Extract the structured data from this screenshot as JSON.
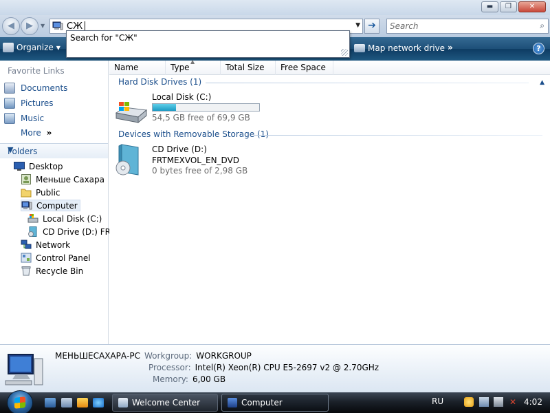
{
  "window": {
    "buttons": {
      "minimize": "▬",
      "maximize": "❐",
      "close": "✕"
    }
  },
  "address": {
    "value": "СЖ",
    "autocomplete": "Search for \"СЖ\""
  },
  "search": {
    "placeholder": "Search"
  },
  "toolbar": {
    "organize": "Organize",
    "map_network_drive": "Map network drive",
    "more": "»",
    "help": "?"
  },
  "nav": {
    "favorites_header": "Favorite Links",
    "favorites": [
      {
        "label": "Documents",
        "icon": "documents-icon"
      },
      {
        "label": "Pictures",
        "icon": "pictures-icon"
      },
      {
        "label": "Music",
        "icon": "music-icon"
      }
    ],
    "more": "More",
    "folders_header": "Folders",
    "tree": [
      {
        "label": "Desktop",
        "icon": "desktop-icon"
      },
      {
        "label": "Меньше Сахара",
        "icon": "user-folder-icon"
      },
      {
        "label": "Public",
        "icon": "folder-icon"
      },
      {
        "label": "Computer",
        "icon": "computer-icon"
      },
      {
        "label": "Local Disk (C:)",
        "icon": "hard-disk-icon"
      },
      {
        "label": "CD Drive (D:) FRT",
        "icon": "cd-drive-icon"
      },
      {
        "label": "Network",
        "icon": "network-icon"
      },
      {
        "label": "Control Panel",
        "icon": "control-panel-icon"
      },
      {
        "label": "Recycle Bin",
        "icon": "recycle-bin-icon"
      }
    ]
  },
  "columns": [
    "Name",
    "Type",
    "Total Size",
    "Free Space"
  ],
  "groups": {
    "hard_disks": "Hard Disk Drives (1)",
    "removable": "Devices with Removable Storage (1)"
  },
  "drives": {
    "c": {
      "name": "Local Disk (C:)",
      "free_text": "54,5 GB free of 69,9 GB",
      "used_fraction": 0.22
    },
    "d": {
      "name": "CD Drive (D:)",
      "label": "FRTMEXVOL_EN_DVD",
      "free_text": "0 bytes free of 2,98 GB"
    }
  },
  "details": {
    "computer_name": "МЕНЬШЕСАХАРА-PC",
    "workgroup_label": "Workgroup:",
    "workgroup": "WORKGROUP",
    "processor_label": "Processor:",
    "processor": "Intel(R) Xeon(R) CPU E5-2697 v2 @ 2.70GHz",
    "memory_label": "Memory:",
    "memory": "6,00 GB"
  },
  "taskbar": {
    "tasks": [
      "Welcome Center",
      "Computer"
    ],
    "language": "RU",
    "clock": "4:02"
  }
}
